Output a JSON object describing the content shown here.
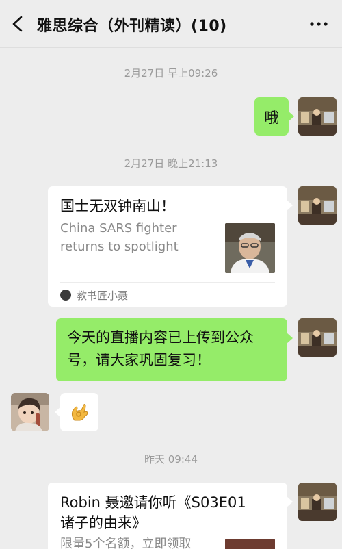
{
  "header": {
    "title": "雅思综合（外刊精读）(10)",
    "back_icon": "chevron-left-icon",
    "more_icon": "more-dots-icon"
  },
  "messages": {
    "ts1": "2月27日 早上09:26",
    "msg1": "哦",
    "ts2": "2月27日 晚上21:13",
    "card1": {
      "title": "国士无双钟南山！",
      "desc_line1": "China SARS fighter",
      "desc_line2": "returns to spotlight",
      "source": "教书匠小聂"
    },
    "msg2_line1": "今天的直播内容已上传到公众",
    "msg2_line2": "号，请大家巩固复习！",
    "msg3_icon": "ok-hand-emoji-icon",
    "ts3": "昨天 09:44",
    "card2": {
      "title_line1": "Robin 聂邀请你听《S03E01",
      "title_line2": "诸子的由来》",
      "desc": "限量5个名额，立即领取"
    }
  },
  "colors": {
    "background": "#ededed",
    "bubble_self": "#95ec69",
    "bubble_other": "#ffffff",
    "timestamp": "#9a9a9a"
  }
}
